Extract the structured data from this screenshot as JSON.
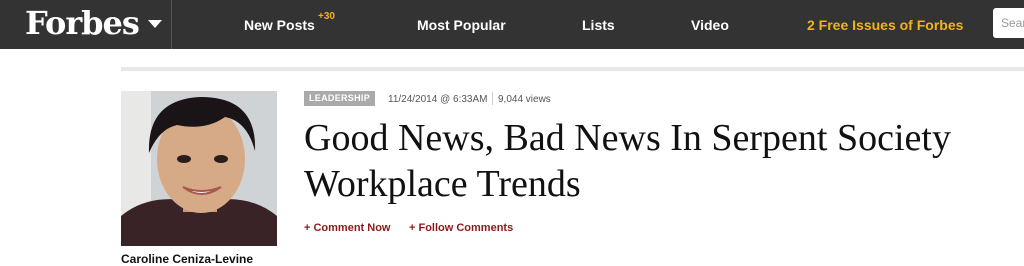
{
  "nav": {
    "logo": "Forbes",
    "items": [
      {
        "label": "New Posts",
        "badge": "+30"
      },
      {
        "label": "Most Popular"
      },
      {
        "label": "Lists"
      },
      {
        "label": "Video"
      },
      {
        "label": "2 Free Issues of Forbes"
      }
    ],
    "search_placeholder": "Sear",
    "colors": {
      "bar": "#333333",
      "accent": "#f2b31a"
    }
  },
  "article": {
    "category": "LEADERSHIP",
    "date": "11/24/2014 @ 6:33AM",
    "views": "9,044 views",
    "headline": "Good News, Bad News In Serpent Society Workplace Trends",
    "actions": [
      "+ Comment Now",
      "+ Follow Comments"
    ],
    "author": "Caroline Ceniza-Levine",
    "colors": {
      "action": "#8b1a1a",
      "category_bg": "#aaaaaa"
    }
  }
}
